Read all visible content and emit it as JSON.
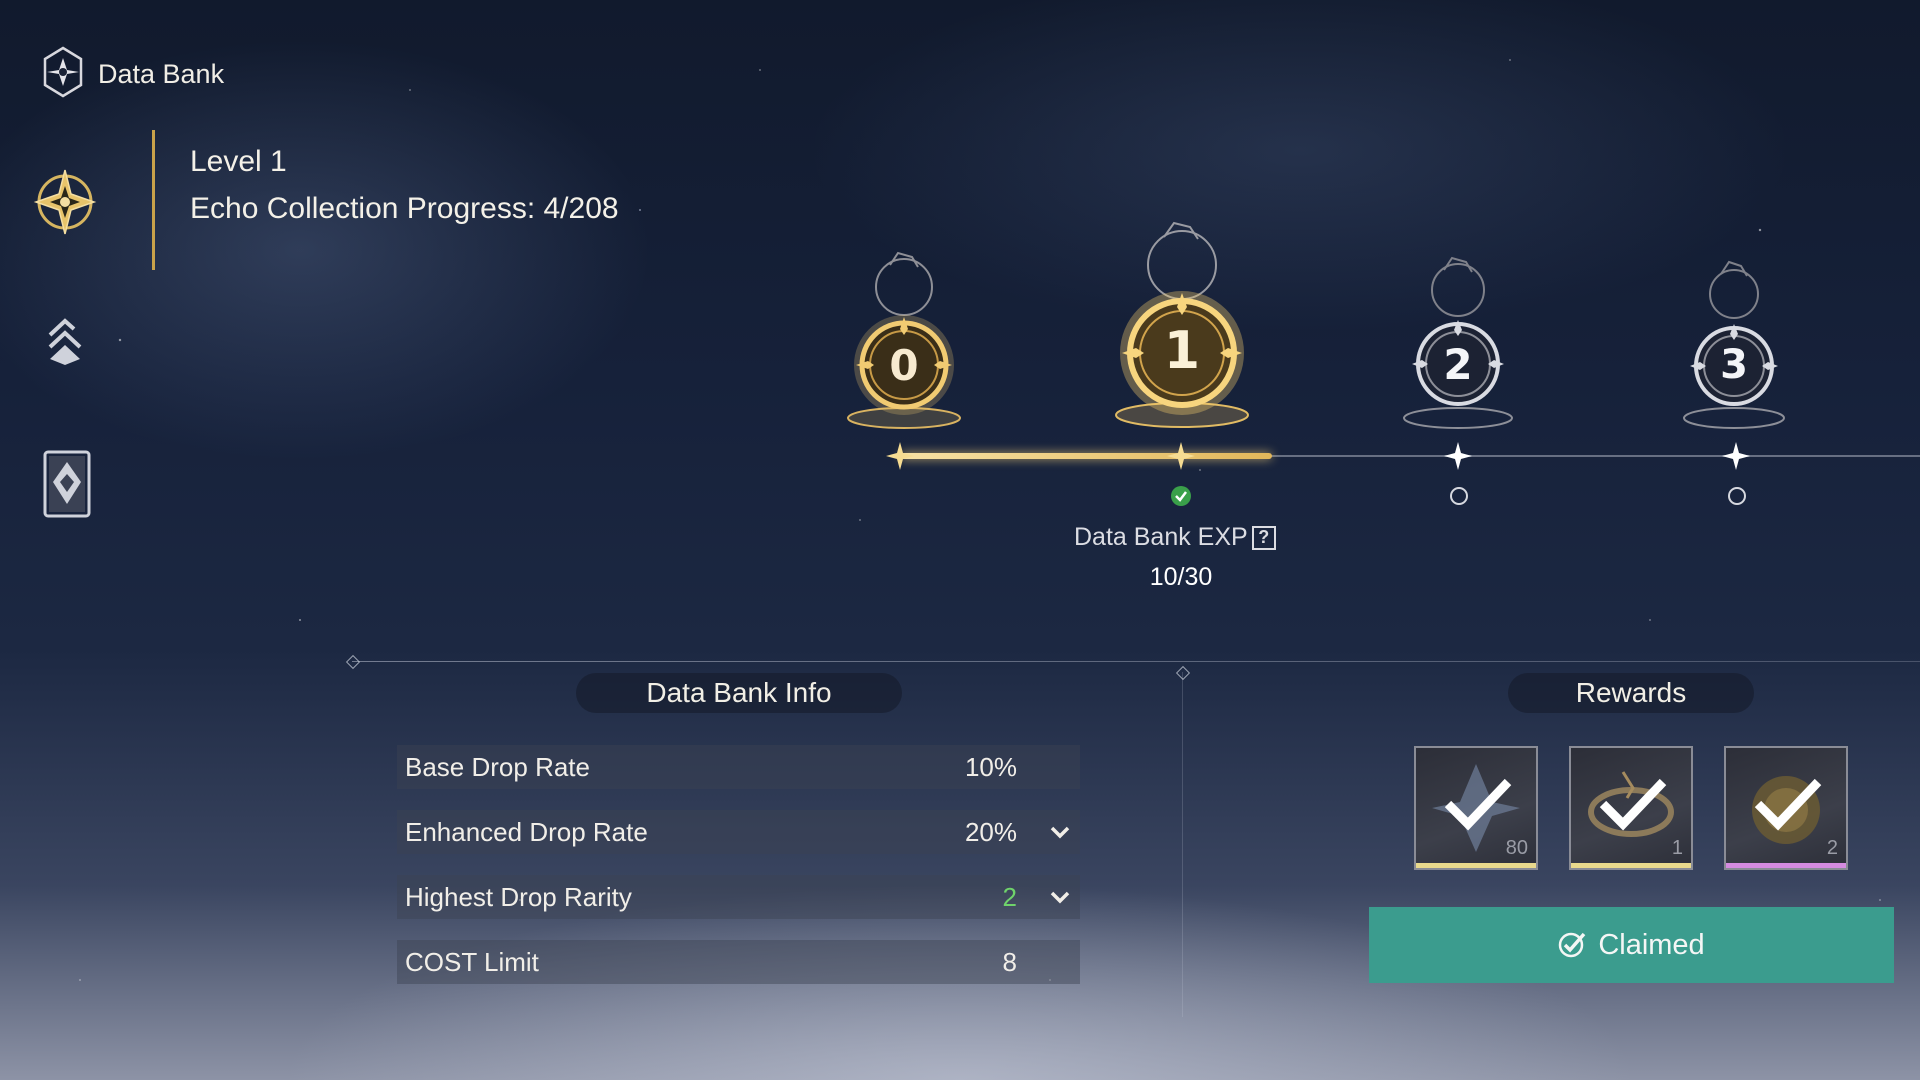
{
  "nav": {
    "title": "Data Bank",
    "icons": [
      "data-bank-emblem-icon",
      "data-bank-tab-icon",
      "stack-tab-icon",
      "card-tab-icon"
    ]
  },
  "header": {
    "level": "Level 1",
    "progress": "Echo Collection Progress: 4/208"
  },
  "track": {
    "nodes": [
      {
        "label": "0",
        "state": "reached"
      },
      {
        "label": "1",
        "state": "current"
      },
      {
        "label": "2",
        "state": "locked"
      },
      {
        "label": "3",
        "state": "locked"
      }
    ],
    "exp_label": "Data Bank EXP",
    "exp_help": "?",
    "exp_value": "10/30",
    "exp_fraction": 0.333
  },
  "info": {
    "title": "Data Bank Info",
    "rows": [
      {
        "label": "Base Drop Rate",
        "value": "10%",
        "expandable": false
      },
      {
        "label": "Enhanced Drop Rate",
        "value": "20%",
        "expandable": true
      },
      {
        "label": "Highest Drop Rarity",
        "value": "2",
        "expandable": true
      },
      {
        "label": "COST Limit",
        "value": "8",
        "expandable": false
      }
    ]
  },
  "rewards": {
    "title": "Rewards",
    "items": [
      {
        "qty": "80",
        "rarity_color": "#e9d98c"
      },
      {
        "qty": "1",
        "rarity_color": "#e9d98c"
      },
      {
        "qty": "2",
        "rarity_color": "#d58be0"
      }
    ],
    "claim_label": "Claimed"
  },
  "colors": {
    "gold": "#e2b75a",
    "claimed_button": "#3b9c8e",
    "rarity_green": "#6fd36b"
  }
}
